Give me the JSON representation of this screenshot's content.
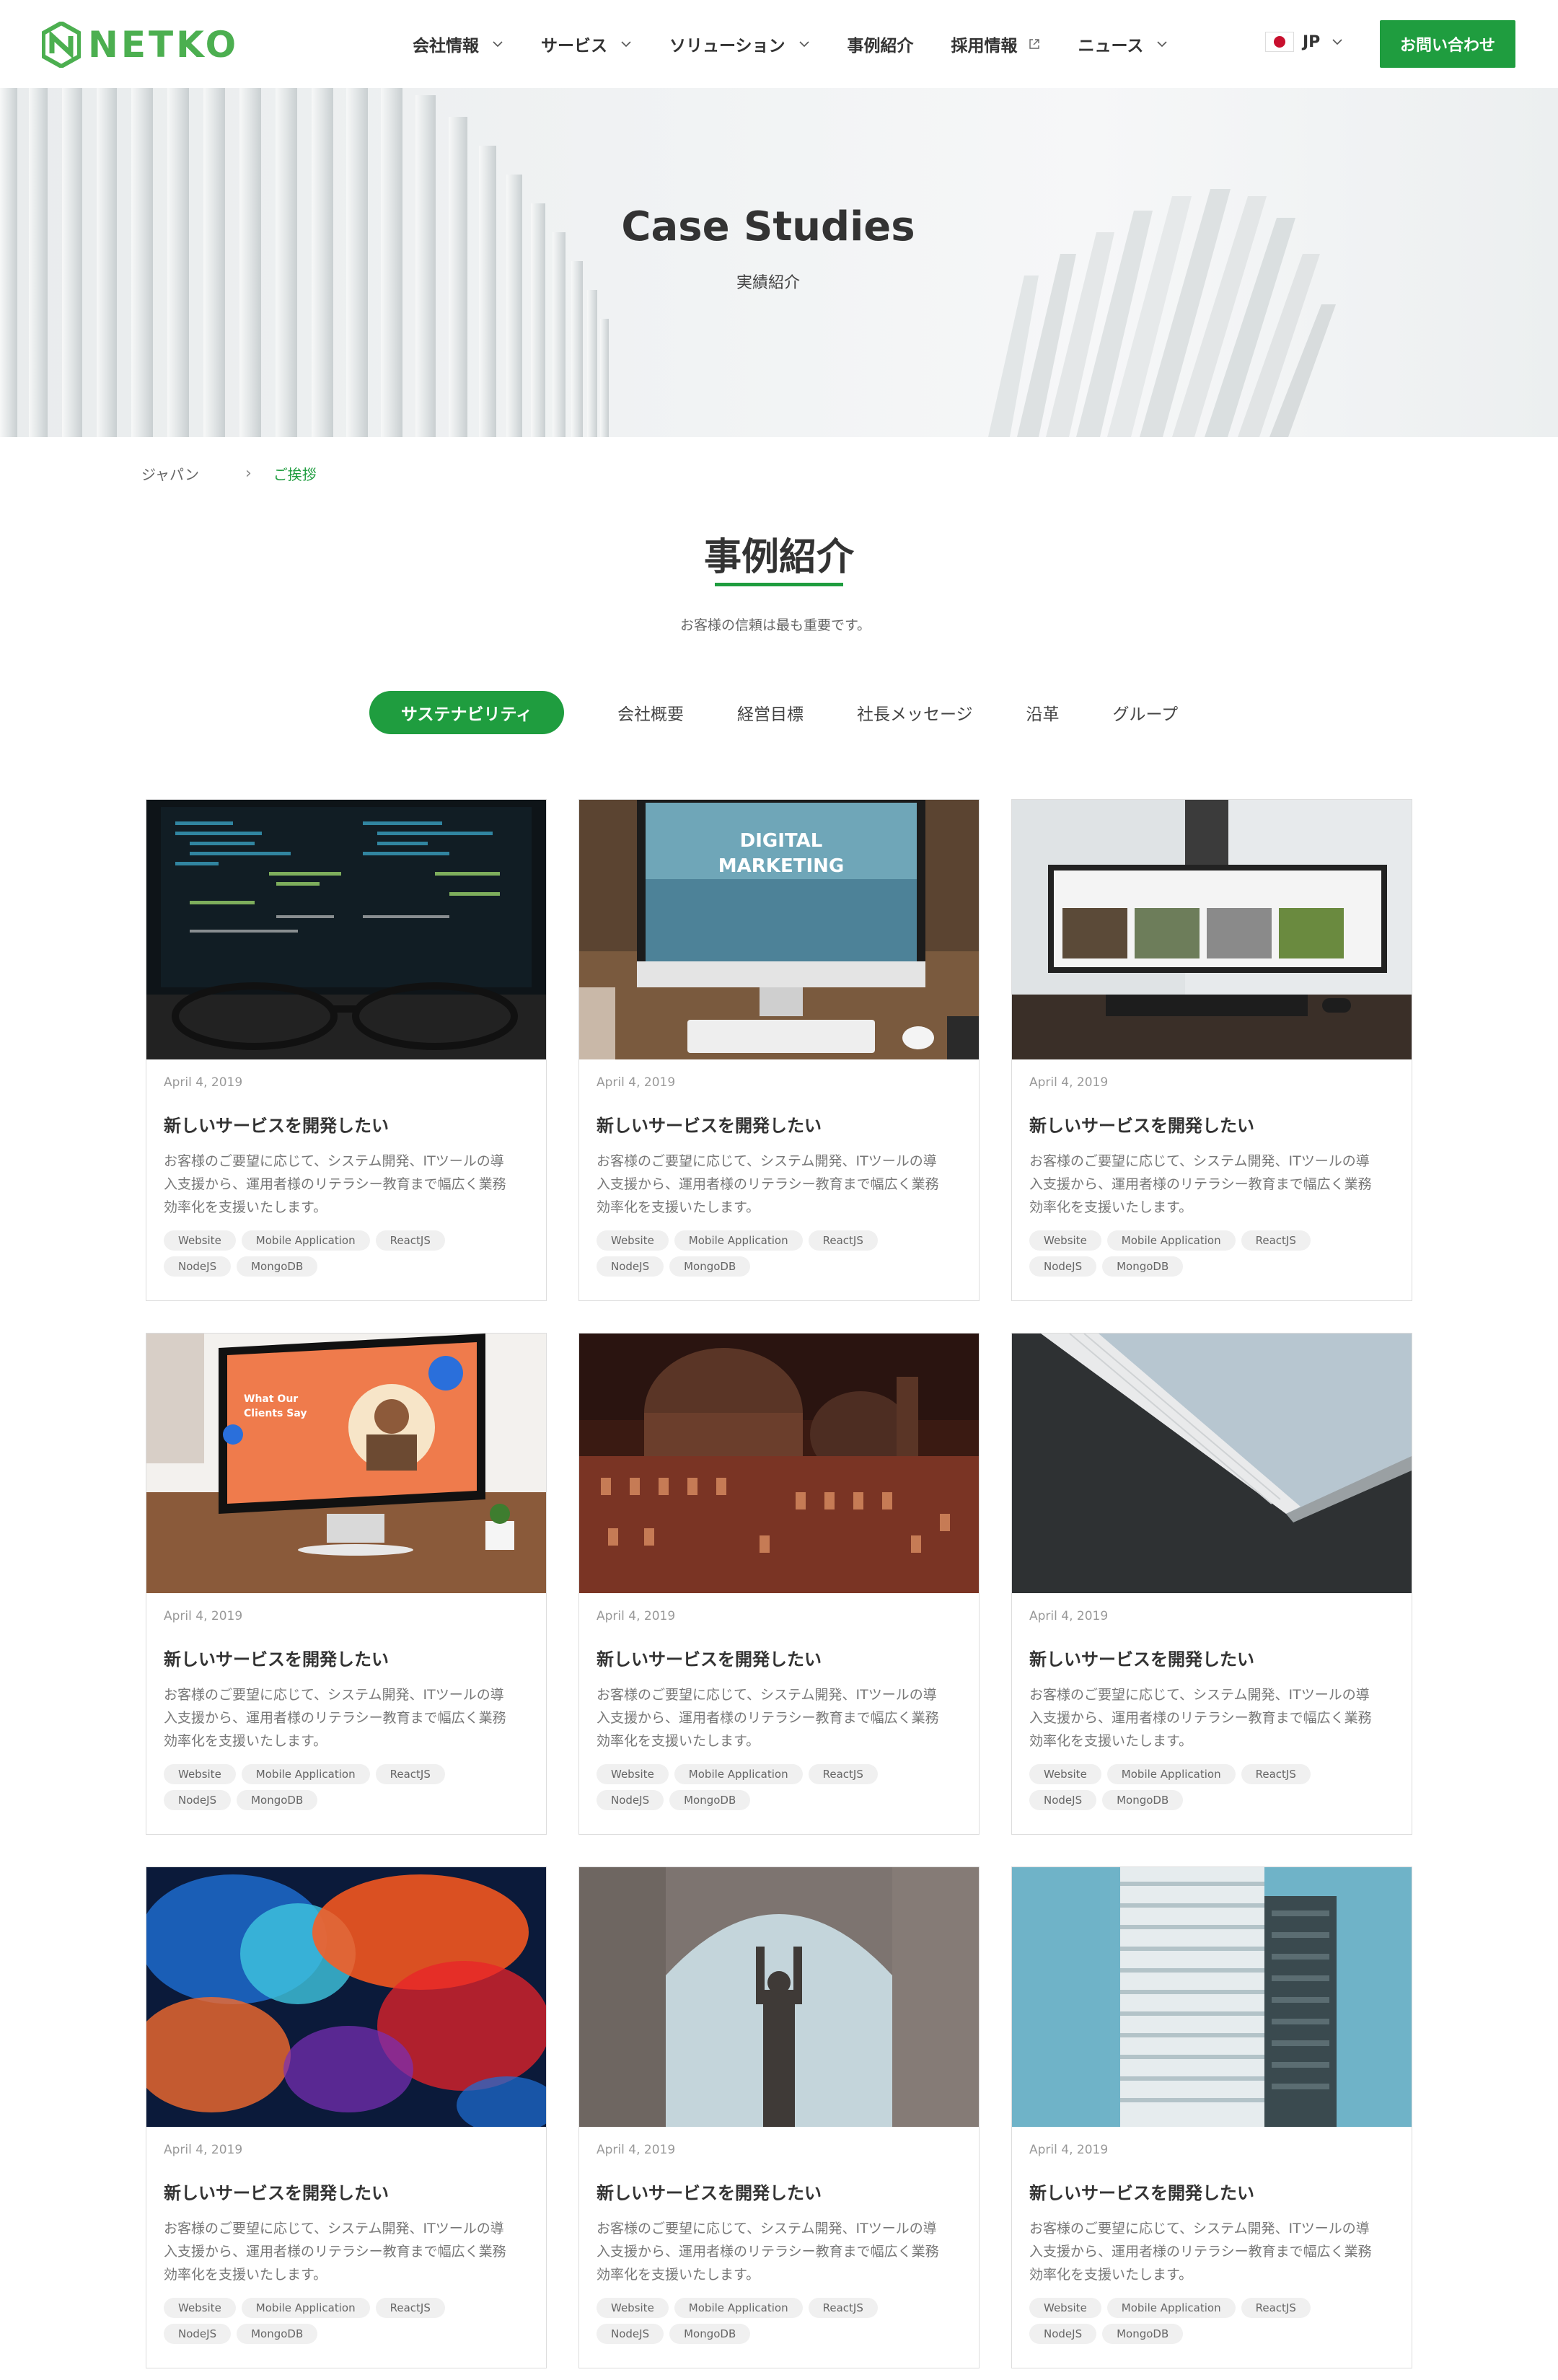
{
  "header": {
    "logo_text": "NETKO",
    "nav": [
      {
        "label": "会社情報",
        "icon": "chevron-down-icon"
      },
      {
        "label": "サービス",
        "icon": "chevron-down-icon"
      },
      {
        "label": "ソリューション",
        "icon": "chevron-down-icon"
      },
      {
        "label": "事例紹介",
        "icon": ""
      },
      {
        "label": "採用情報",
        "icon": "external-link-icon"
      },
      {
        "label": "ニュース",
        "icon": "chevron-down-icon"
      }
    ],
    "lang_label": "JP",
    "contact_label": "お問い合わせ",
    "accent_color": "#1f9d3f"
  },
  "hero": {
    "title": "Case Studies",
    "subtitle": "実績紹介"
  },
  "breadcrumb": {
    "home": "ジャパン",
    "separator": "›",
    "current": "ご挨拶"
  },
  "section": {
    "title": "事例紹介",
    "description": "お客様の信頼は最も重要です。"
  },
  "tabs": [
    {
      "label": "サステナビリティ",
      "active": true
    },
    {
      "label": "会社概要",
      "active": false
    },
    {
      "label": "経営目標",
      "active": false
    },
    {
      "label": "社長メッセージ",
      "active": false
    },
    {
      "label": "沿革",
      "active": false
    },
    {
      "label": "グループ",
      "active": false
    }
  ],
  "cards": [
    {
      "image": "code-monitor-glasses",
      "date": "April 4, 2019",
      "title": "新しいサービスを開発したい",
      "description": "お客様のご要望に応じて、システム開発、ITツールの導入支援から、運用者様のリテラシー教育まで幅広く業務効率化を支援いたします。",
      "tags": [
        "Website",
        "Mobile Application",
        "ReactJS",
        "NodeJS",
        "MongoDB"
      ]
    },
    {
      "image": "digital-marketing-imac",
      "image_text": [
        "DIGITAL",
        "MARKETING"
      ],
      "date": "April 4, 2019",
      "title": "新しいサービスを開発したい",
      "description": "お客様のご要望に応じて、システム開発、ITツールの導入支援から、運用者様のリテラシー教育まで幅広く業務効率化を支援いたします。",
      "tags": [
        "Website",
        "Mobile Application",
        "ReactJS",
        "NodeJS",
        "MongoDB"
      ]
    },
    {
      "image": "desk-monitor-photos",
      "date": "April 4, 2019",
      "title": "新しいサービスを開発したい",
      "description": "お客様のご要望に応じて、システム開発、ITツールの導入支援から、運用者様のリテラシー教育まで幅広く業務効率化を支援いたします。",
      "tags": [
        "Website",
        "Mobile Application",
        "ReactJS",
        "NodeJS",
        "MongoDB"
      ]
    },
    {
      "image": "imac-clients-say",
      "image_text": [
        "What Our",
        "Clients Say"
      ],
      "date": "April 4, 2019",
      "title": "新しいサービスを開発したい",
      "description": "お客様のご要望に応じて、システム開発、ITツールの導入支援から、運用者様のリテラシー教育まで幅広く業務効率化を支援いたします。",
      "tags": [
        "Website",
        "Mobile Application",
        "ReactJS",
        "NodeJS",
        "MongoDB"
      ]
    },
    {
      "image": "cathedral-night",
      "date": "April 4, 2019",
      "title": "新しいサービスを開発したい",
      "description": "お客様のご要望に応じて、システム開発、ITツールの導入支援から、運用者様のリテラシー教育まで幅広く業務効率化を支援いたします。",
      "tags": [
        "Website",
        "Mobile Application",
        "ReactJS",
        "NodeJS",
        "MongoDB"
      ]
    },
    {
      "image": "building-roof-sky",
      "date": "April 4, 2019",
      "title": "新しいサービスを開発したい",
      "description": "お客様のご要望に応じて、システム開発、ITツールの導入支援から、運用者様のリテラシー教育まで幅広く業務効率化を支援いたします。",
      "tags": [
        "Website",
        "Mobile Application",
        "ReactJS",
        "NodeJS",
        "MongoDB"
      ]
    },
    {
      "image": "colorful-smoke",
      "date": "April 4, 2019",
      "title": "新しいサービスを開発したい",
      "description": "お客様のご要望に応じて、システム開発、ITツールの導入支援から、運用者様のリテラシー教育まで幅広く業務効率化を支援いたします。",
      "tags": [
        "Website",
        "Mobile Application",
        "ReactJS",
        "NodeJS",
        "MongoDB"
      ]
    },
    {
      "image": "arch-statue",
      "date": "April 4, 2019",
      "title": "新しいサービスを開発したい",
      "description": "お客様のご要望に応じて、システム開発、ITツールの導入支援から、運用者様のリテラシー教育まで幅広く業務効率化を支援いたします。",
      "tags": [
        "Website",
        "Mobile Application",
        "ReactJS",
        "NodeJS",
        "MongoDB"
      ]
    },
    {
      "image": "tower-building",
      "date": "April 4, 2019",
      "title": "新しいサービスを開発したい",
      "description": "お客様のご要望に応じて、システム開発、ITツールの導入支援から、運用者様のリテラシー教育まで幅広く業務効率化を支援いたします。",
      "tags": [
        "Website",
        "Mobile Application",
        "ReactJS",
        "NodeJS",
        "MongoDB"
      ]
    }
  ]
}
